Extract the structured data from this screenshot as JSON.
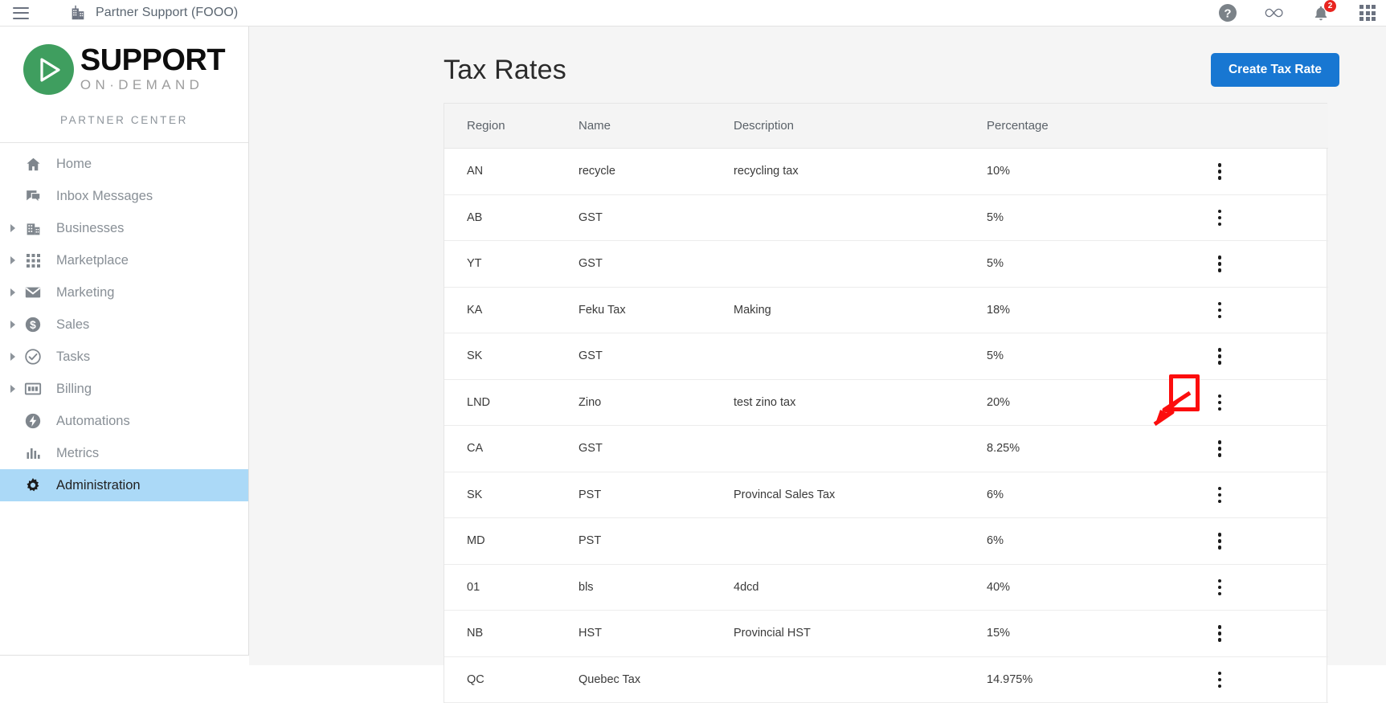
{
  "topbar": {
    "menu_icon": "hamburger-icon",
    "org_icon": "building-icon",
    "title": "Partner Support (FOOO)",
    "help_icon": "help-circle-icon",
    "loop_icon": "infinity-icon",
    "bell_icon": "bell-icon",
    "notification_count": "2",
    "apps_icon": "apps-grid-icon"
  },
  "sidebar": {
    "brand": {
      "logo_icon": "play-circle-logo-icon",
      "primary": "SUPPORT",
      "secondary": "ON·DEMAND",
      "subtitle": "PARTNER CENTER"
    },
    "items": [
      {
        "label": "Home",
        "icon": "home-icon",
        "expandable": false,
        "active": false
      },
      {
        "label": "Inbox Messages",
        "icon": "chat-icon",
        "expandable": false,
        "active": false
      },
      {
        "label": "Businesses",
        "icon": "building-icon",
        "expandable": true,
        "active": false
      },
      {
        "label": "Marketplace",
        "icon": "grid-dots-icon",
        "expandable": true,
        "active": false
      },
      {
        "label": "Marketing",
        "icon": "envelope-icon",
        "expandable": true,
        "active": false
      },
      {
        "label": "Sales",
        "icon": "dollar-circle-icon",
        "expandable": true,
        "active": false
      },
      {
        "label": "Tasks",
        "icon": "check-circle-icon",
        "expandable": true,
        "active": false
      },
      {
        "label": "Billing",
        "icon": "calculator-icon",
        "expandable": true,
        "active": false
      },
      {
        "label": "Automations",
        "icon": "bolt-circle-icon",
        "expandable": false,
        "active": false
      },
      {
        "label": "Metrics",
        "icon": "bar-chart-icon",
        "expandable": false,
        "active": false
      },
      {
        "label": "Administration",
        "icon": "gear-icon",
        "expandable": false,
        "active": true
      }
    ]
  },
  "main": {
    "page_title": "Tax Rates",
    "create_button": "Create Tax Rate",
    "table": {
      "columns": [
        "Region",
        "Name",
        "Description",
        "Percentage",
        ""
      ],
      "row_action_icon": "kebab-menu-icon",
      "rows": [
        {
          "region": "AN",
          "name": "recycle",
          "description": "recycling tax",
          "percentage": "10%"
        },
        {
          "region": "AB",
          "name": "GST",
          "description": "",
          "percentage": "5%"
        },
        {
          "region": "YT",
          "name": "GST",
          "description": "",
          "percentage": "5%"
        },
        {
          "region": "KA",
          "name": "Feku Tax",
          "description": "Making",
          "percentage": "18%"
        },
        {
          "region": "SK",
          "name": "GST",
          "description": "",
          "percentage": "5%"
        },
        {
          "region": "LND",
          "name": "Zino",
          "description": "test zino tax",
          "percentage": "20%"
        },
        {
          "region": "CA",
          "name": "GST",
          "description": "",
          "percentage": "8.25%"
        },
        {
          "region": "SK",
          "name": "PST",
          "description": "Provincal Sales Tax",
          "percentage": "6%"
        },
        {
          "region": "MD",
          "name": "PST",
          "description": "",
          "percentage": "6%"
        },
        {
          "region": "01",
          "name": "bls",
          "description": "4dcd",
          "percentage": "40%"
        },
        {
          "region": "NB",
          "name": "HST",
          "description": "Provincial HST",
          "percentage": "15%"
        },
        {
          "region": "QC",
          "name": "Quebec Tax",
          "description": "",
          "percentage": "14.975%"
        }
      ]
    }
  },
  "annotation": {
    "highlight_color": "#fc0d0d",
    "target": "kebab-menu-icon for row LND"
  },
  "colors": {
    "accent_button": "#1877d2",
    "active_nav": "#abd9f7",
    "brand_green": "#3f9e5f",
    "badge_red": "#e8241f"
  }
}
